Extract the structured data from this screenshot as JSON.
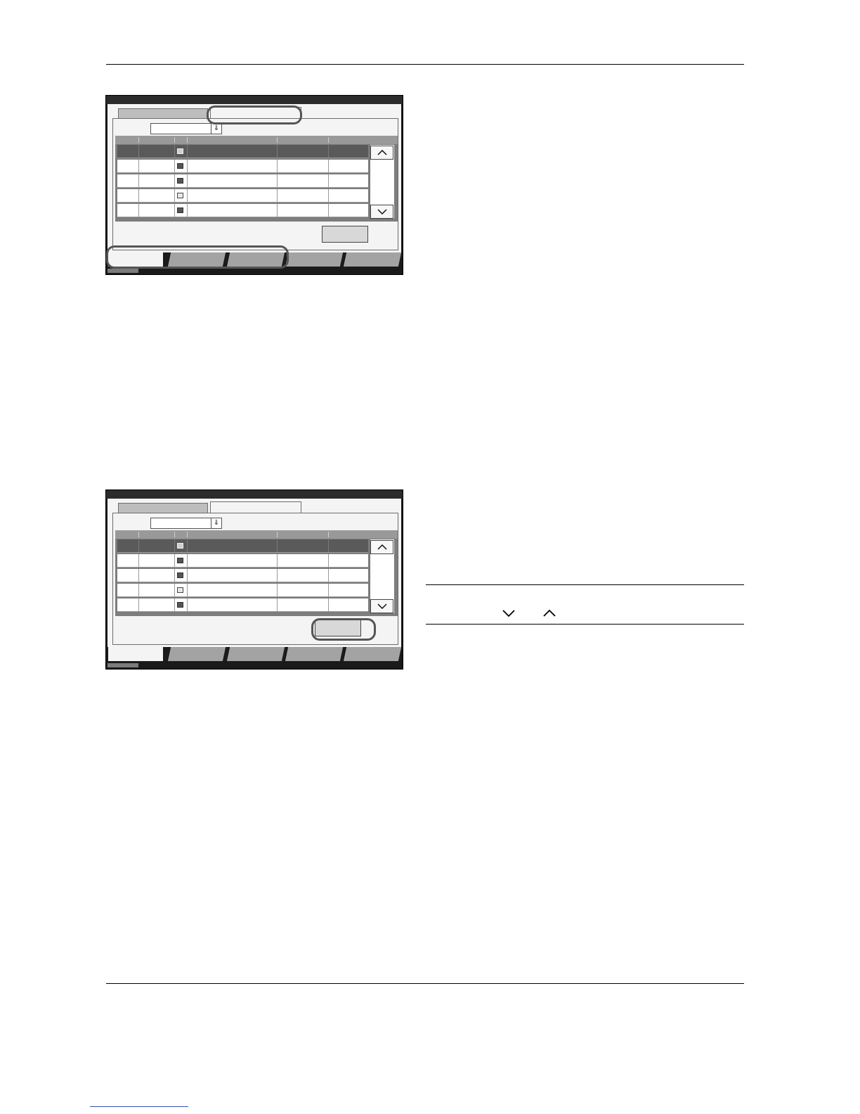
{
  "screens": [
    {
      "tabs": [
        "",
        ""
      ],
      "table_rows": 5,
      "selected_row": 0,
      "row_icons": [
        "file",
        "file",
        "file",
        "pdf",
        "file"
      ],
      "highlights": [
        "second-tab",
        "bottom-tabs"
      ]
    },
    {
      "tabs": [
        "",
        ""
      ],
      "table_rows": 5,
      "selected_row": 0,
      "row_icons": [
        "file",
        "file",
        "file",
        "pdf",
        "file"
      ],
      "highlights": [
        "ok-button"
      ]
    }
  ],
  "note": {
    "icons": [
      "chevron-down-icon",
      "chevron-up-icon"
    ]
  }
}
